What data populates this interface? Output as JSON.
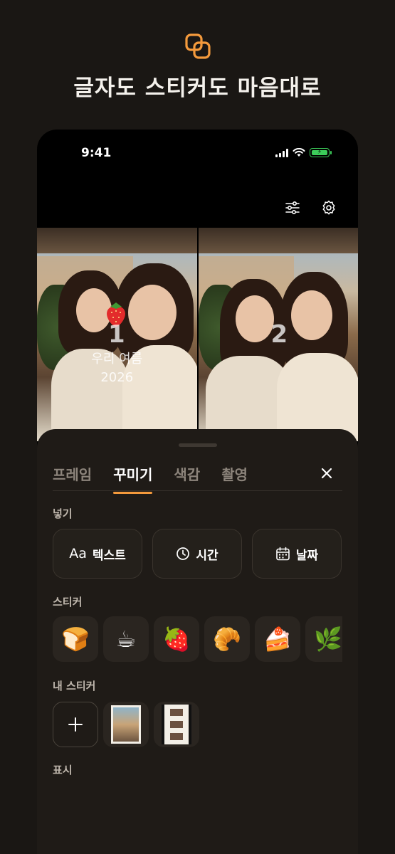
{
  "hero": {
    "title": "글자도 스티커도 마음대로",
    "accent": "#f49a3c"
  },
  "status_bar": {
    "time": "9:41"
  },
  "photos": [
    {
      "number": "1",
      "caption_line1": "우리 여름",
      "caption_line2": "2026"
    },
    {
      "number": "2"
    }
  ],
  "tabs": [
    {
      "label": "프레임",
      "active": false
    },
    {
      "label": "꾸미기",
      "active": true
    },
    {
      "label": "색감",
      "active": false
    },
    {
      "label": "촬영",
      "active": false
    }
  ],
  "sections": {
    "insert": "넣기",
    "stickers": "스티커",
    "my_stickers": "내 스티커",
    "display": "표시"
  },
  "insert_buttons": [
    {
      "icon_text": "Aa",
      "label": "텍스트"
    },
    {
      "icon": "clock-icon",
      "label": "시간"
    },
    {
      "icon": "calendar-icon",
      "label": "날짜"
    }
  ],
  "stickers": [
    {
      "name": "bread",
      "glyph": "🍞"
    },
    {
      "name": "coffee",
      "glyph": "☕"
    },
    {
      "name": "strawberry",
      "glyph": "🍓"
    },
    {
      "name": "croissant",
      "glyph": "🥐"
    },
    {
      "name": "cake",
      "glyph": "🍰"
    },
    {
      "name": "herb",
      "glyph": "🌿"
    }
  ]
}
